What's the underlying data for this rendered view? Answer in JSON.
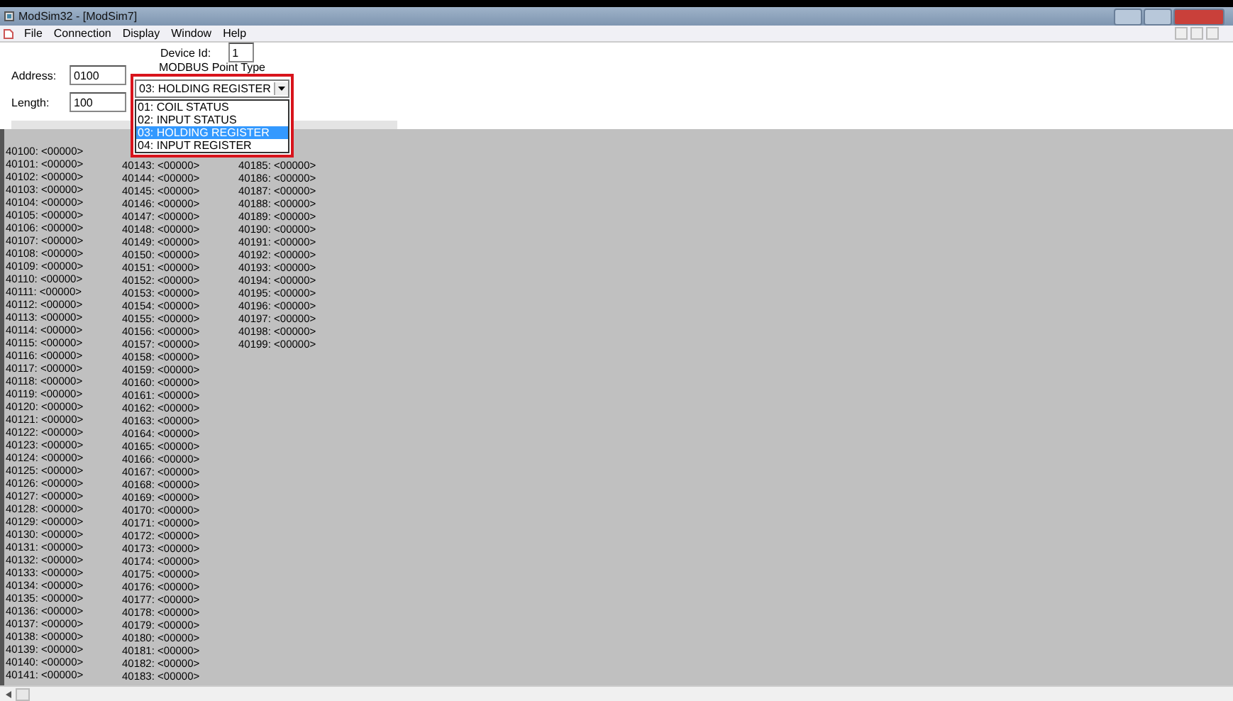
{
  "window": {
    "title": "ModSim32 - [ModSim7]"
  },
  "menu": [
    "File",
    "Connection",
    "Display",
    "Window",
    "Help"
  ],
  "device_id": {
    "label": "Device Id:",
    "value": "1"
  },
  "address": {
    "label": "Address:",
    "value": "0100"
  },
  "length": {
    "label": "Length:",
    "value": "100"
  },
  "point_type": {
    "label": "MODBUS Point Type",
    "value": "03: HOLDING REGISTER",
    "expanded": true,
    "options": [
      {
        "label": "01: COIL STATUS",
        "selected": false
      },
      {
        "label": "02: INPUT STATUS",
        "selected": false
      },
      {
        "label": "03: HOLDING REGISTER",
        "selected": true
      },
      {
        "label": "04: INPUT REGISTER",
        "selected": false
      }
    ]
  },
  "registers": [
    [
      "40100: <00000>",
      "40101: <00000>",
      "40102: <00000>",
      "40103: <00000>",
      "40104: <00000>",
      "40105: <00000>",
      "40106: <00000>",
      "40107: <00000>",
      "40108: <00000>",
      "40109: <00000>",
      "40110: <00000>",
      "40111: <00000>",
      "40112: <00000>",
      "40113: <00000>",
      "40114: <00000>",
      "40115: <00000>",
      "40116: <00000>",
      "40117: <00000>",
      "40118: <00000>",
      "40119: <00000>",
      "40120: <00000>",
      "40121: <00000>",
      "40122: <00000>",
      "40123: <00000>",
      "40124: <00000>",
      "40125: <00000>",
      "40126: <00000>",
      "40127: <00000>",
      "40128: <00000>",
      "40129: <00000>",
      "40130: <00000>",
      "40131: <00000>",
      "40132: <00000>",
      "40133: <00000>",
      "40134: <00000>",
      "40135: <00000>",
      "40136: <00000>",
      "40137: <00000>",
      "40138: <00000>",
      "40139: <00000>",
      "40140: <00000>",
      "40141: <00000>"
    ],
    [
      "40143: <00000>",
      "40144: <00000>",
      "40145: <00000>",
      "40146: <00000>",
      "40147: <00000>",
      "40148: <00000>",
      "40149: <00000>",
      "40150: <00000>",
      "40151: <00000>",
      "40152: <00000>",
      "40153: <00000>",
      "40154: <00000>",
      "40155: <00000>",
      "40156: <00000>",
      "40157: <00000>",
      "40158: <00000>",
      "40159: <00000>",
      "40160: <00000>",
      "40161: <00000>",
      "40162: <00000>",
      "40163: <00000>",
      "40164: <00000>",
      "40165: <00000>",
      "40166: <00000>",
      "40167: <00000>",
      "40168: <00000>",
      "40169: <00000>",
      "40170: <00000>",
      "40171: <00000>",
      "40172: <00000>",
      "40173: <00000>",
      "40174: <00000>",
      "40175: <00000>",
      "40176: <00000>",
      "40177: <00000>",
      "40178: <00000>",
      "40179: <00000>",
      "40180: <00000>",
      "40181: <00000>",
      "40182: <00000>",
      "40183: <00000>"
    ],
    [
      "40185: <00000>",
      "40186: <00000>",
      "40187: <00000>",
      "40188: <00000>",
      "40189: <00000>",
      "40190: <00000>",
      "40191: <00000>",
      "40192: <00000>",
      "40193: <00000>",
      "40194: <00000>",
      "40195: <00000>",
      "40196: <00000>",
      "40197: <00000>",
      "40198: <00000>",
      "40199: <00000>"
    ]
  ]
}
